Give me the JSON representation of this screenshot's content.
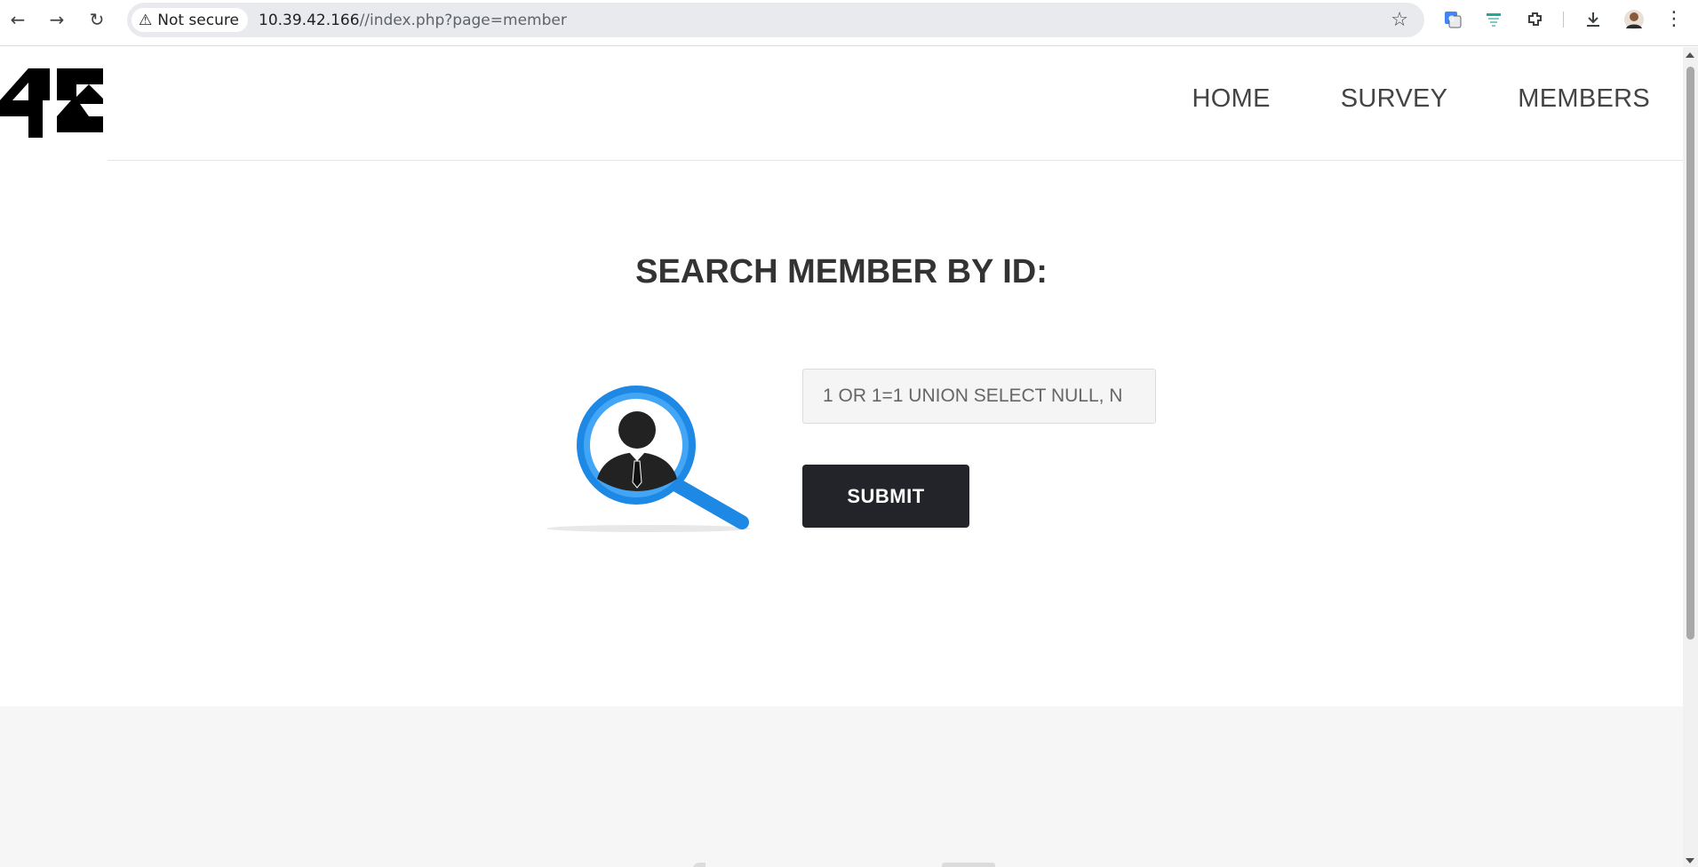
{
  "browser": {
    "security_label": "Not secure",
    "url_host": "10.39.42.166",
    "url_path": "//index.php?page=member"
  },
  "nav": {
    "items": [
      {
        "label": "HOME"
      },
      {
        "label": "SURVEY"
      },
      {
        "label": "MEMBERS"
      }
    ]
  },
  "logo": {
    "text": "42"
  },
  "main": {
    "title": "SEARCH MEMBER BY ID:",
    "id_input_value": "1 OR 1=1 UNION SELECT NULL, N",
    "submit_label": "SUBMIT"
  },
  "colors": {
    "accent_blue": "#1e88e5",
    "button_dark": "#23242a",
    "footer_bg": "#f6f6f6"
  }
}
